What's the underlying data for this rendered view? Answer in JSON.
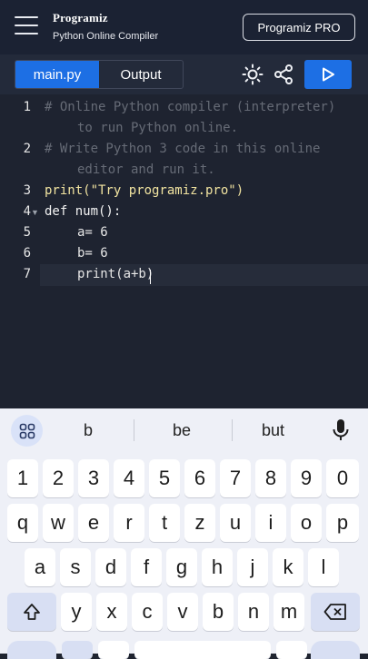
{
  "header": {
    "brand": "Programiz",
    "subtitle": "Python Online Compiler",
    "pro_label": "Programiz PRO"
  },
  "toolbar": {
    "tabs": [
      "main.py",
      "Output"
    ],
    "active_tab": "main.py",
    "accent": "#1d6fe4"
  },
  "editor": {
    "line_numbers": [
      "1",
      "2",
      "3",
      "4",
      "5",
      "6",
      "7"
    ],
    "lines": [
      "# Online Python compiler (interpreter)",
      "to run Python online.",
      "# Write Python 3 code in this online",
      "editor and run it.",
      "print(\"Try programiz.pro\")",
      "def num():",
      "a= 6",
      "b= 6",
      "print(a+b)"
    ]
  },
  "keyboard": {
    "suggestions": [
      "b",
      "be",
      "but"
    ],
    "row_digits": [
      "1",
      "2",
      "3",
      "4",
      "5",
      "6",
      "7",
      "8",
      "9",
      "0"
    ],
    "row_1": [
      "q",
      "w",
      "e",
      "r",
      "t",
      "z",
      "u",
      "i",
      "o",
      "p"
    ],
    "row_2": [
      "a",
      "s",
      "d",
      "f",
      "g",
      "h",
      "j",
      "k",
      "l"
    ],
    "row_3": [
      "y",
      "x",
      "c",
      "v",
      "b",
      "n",
      "m"
    ]
  }
}
